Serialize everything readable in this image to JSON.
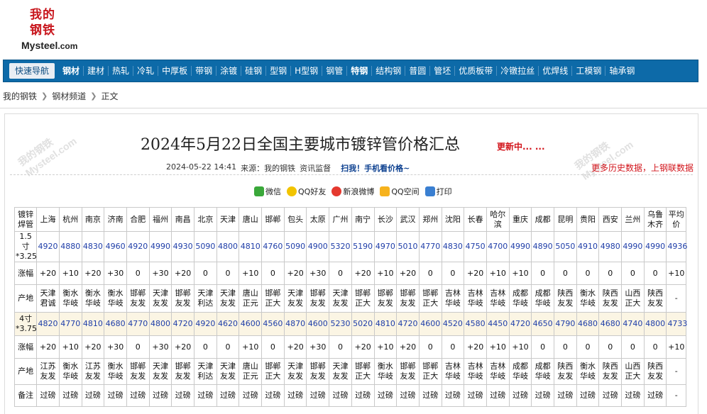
{
  "logo": {
    "zh_line1": "我的",
    "zh_line2": "钢铁",
    "en": "Mysteel",
    "en_suffix": ".com"
  },
  "nav": {
    "quick": "快速导航",
    "items": [
      "钢材",
      "建材",
      "热轧",
      "冷轧",
      "中厚板",
      "带钢",
      "涂镀",
      "硅钢",
      "型钢",
      "H型钢",
      "钢管",
      "特钢",
      "结构钢",
      "普圆",
      "管坯",
      "优质板带",
      "冷镦拉丝",
      "优焊线",
      "工模钢",
      "轴承钢"
    ],
    "bold": [
      "钢材",
      "特钢"
    ]
  },
  "breadcrumb": [
    "我的钢铁",
    "钢材频道",
    "正文"
  ],
  "watermark": {
    "top": "我的钢铁",
    "bottom": "Mysteel.com"
  },
  "article": {
    "title": "2024年5月22日全国主要城市镀锌管价格汇总",
    "updating": "更新中... ...",
    "datetime": "2024-05-22 14:41",
    "source": "来源：我的钢铁",
    "monitor": "资讯监督",
    "scan": "扫我！手机看价格~",
    "more": "更多历史数据，上钢联数据"
  },
  "share": [
    {
      "label": "微信",
      "icon": "wechat-icon"
    },
    {
      "label": "QQ好友",
      "icon": "qq-icon"
    },
    {
      "label": "新浪微博",
      "icon": "weibo-icon"
    },
    {
      "label": "QQ空间",
      "icon": "qzone-icon"
    },
    {
      "label": "打印",
      "icon": "print-icon"
    }
  ],
  "table": {
    "corner": "镀锌焊管",
    "cities": [
      "上海",
      "杭州",
      "南京",
      "济南",
      "合肥",
      "福州",
      "南昌",
      "北京",
      "天津",
      "唐山",
      "邯郸",
      "包头",
      "太原",
      "广州",
      "南宁",
      "长沙",
      "武汉",
      "郑州",
      "沈阳",
      "长春",
      "哈尔滨",
      "重庆",
      "成都",
      "昆明",
      "贵阳",
      "西安",
      "兰州",
      "乌鲁木齐"
    ],
    "avg_label": "平均价",
    "rows": [
      {
        "label": "1.5寸*3.25",
        "kind": "num",
        "shade": false,
        "values": [
          "4920",
          "4880",
          "4830",
          "4960",
          "4920",
          "4990",
          "4930",
          "5090",
          "4800",
          "4810",
          "4760",
          "5090",
          "4900",
          "5320",
          "5190",
          "4970",
          "5010",
          "4770",
          "4830",
          "4750",
          "4700",
          "4990",
          "4890",
          "5050",
          "4910",
          "4980",
          "4990",
          "4990",
          "4936"
        ]
      },
      {
        "label": "涨幅",
        "kind": "chg",
        "shade": false,
        "values": [
          "+20",
          "+10",
          "+20",
          "+30",
          "0",
          "+30",
          "+20",
          "0",
          "0",
          "+10",
          "0",
          "+20",
          "+30",
          "0",
          "+20",
          "+10",
          "+20",
          "0",
          "0",
          "+20",
          "+10",
          "+10",
          "0",
          "0",
          "0",
          "0",
          "0",
          "0",
          "+10"
        ]
      },
      {
        "label": "产地",
        "kind": "org",
        "shade": false,
        "values": [
          "天津君诚",
          "衡水华岐",
          "衡水华岐",
          "衡水华岐",
          "邯郸友发",
          "天津友发",
          "邯郸友发",
          "天津利达",
          "天津友发",
          "唐山正元",
          "邯郸正大",
          "天津友发",
          "邯郸友发",
          "天津友发",
          "邯郸正大",
          "邯郸友发",
          "邯郸友发",
          "邯郸正大",
          "吉林华岐",
          "吉林华岐",
          "吉林华岐",
          "成都华岐",
          "成都华岐",
          "陕西友发",
          "衡水华岐",
          "陕西友发",
          "山西正大",
          "陕西友发",
          "-"
        ]
      },
      {
        "label": "4寸*3.75",
        "kind": "num",
        "shade": true,
        "values": [
          "4820",
          "4770",
          "4810",
          "4680",
          "4770",
          "4800",
          "4720",
          "4920",
          "4620",
          "4600",
          "4560",
          "4870",
          "4600",
          "5230",
          "5020",
          "4810",
          "4720",
          "4600",
          "4520",
          "4580",
          "4450",
          "4720",
          "4650",
          "4790",
          "4680",
          "4680",
          "4740",
          "4800",
          "4733"
        ]
      },
      {
        "label": "涨幅",
        "kind": "chg",
        "shade": false,
        "values": [
          "+20",
          "+10",
          "+20",
          "+30",
          "0",
          "+30",
          "+20",
          "0",
          "0",
          "+10",
          "0",
          "+20",
          "+30",
          "0",
          "+20",
          "+10",
          "+20",
          "0",
          "0",
          "+20",
          "+10",
          "+10",
          "0",
          "0",
          "0",
          "0",
          "0",
          "0",
          "+10"
        ]
      },
      {
        "label": "产地",
        "kind": "org",
        "shade": false,
        "values": [
          "江苏友发",
          "衡水华岐",
          "江苏友发",
          "衡水华岐",
          "邯郸友发",
          "天津友发",
          "邯郸友发",
          "天津利达",
          "天津友发",
          "唐山正元",
          "邯郸正大",
          "天津友发",
          "邯郸友发",
          "天津友发",
          "邯郸正大",
          "衡水华岐",
          "邯郸友发",
          "邯郸正大",
          "吉林华岐",
          "吉林华岐",
          "吉林华岐",
          "成都华岐",
          "成都华岐",
          "陕西友发",
          "衡水华岐",
          "陕西友发",
          "山西正大",
          "陕西友发",
          "-"
        ]
      },
      {
        "label": "备注",
        "kind": "org",
        "shade": false,
        "values": [
          "过磅",
          "过磅",
          "过磅",
          "过磅",
          "过磅",
          "过磅",
          "过磅",
          "过磅",
          "过磅",
          "过磅",
          "过磅",
          "过磅",
          "过磅",
          "过磅",
          "过磅",
          "过磅",
          "过磅",
          "过磅",
          "过磅",
          "过磅",
          "过磅",
          "过磅",
          "过磅",
          "过磅",
          "过磅",
          "过磅",
          "过磅",
          "过磅",
          "-"
        ]
      }
    ]
  }
}
